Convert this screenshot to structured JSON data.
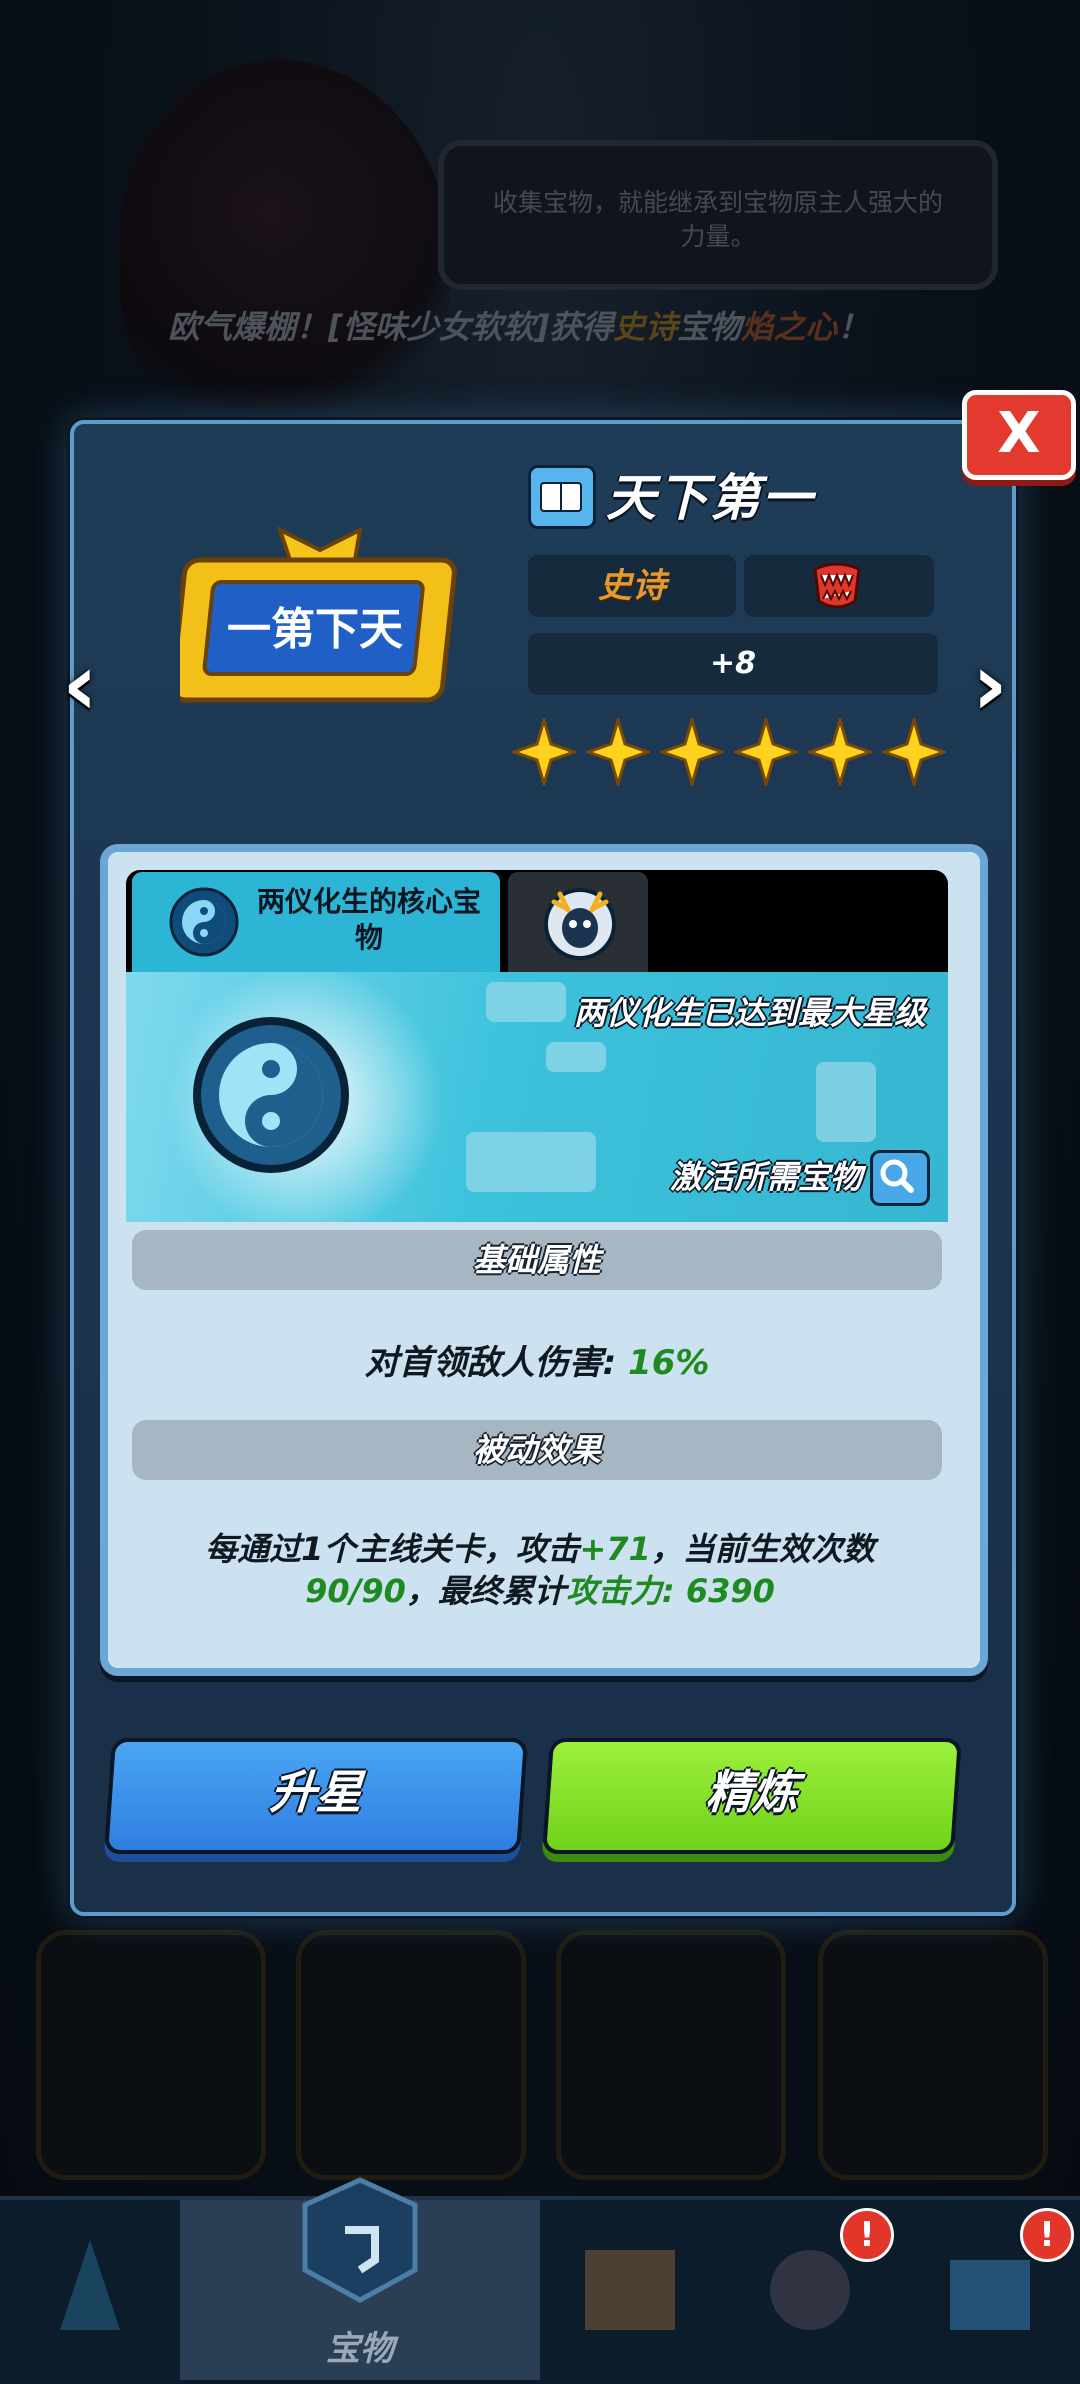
{
  "background": {
    "speech_text": "收集宝物，就能继承到宝物原主人强大的力量。",
    "ticker": {
      "prefix": "欧气爆棚！[怪味少女软软]获得",
      "rarity": "史诗",
      "middle": "宝物",
      "item": "焰之心",
      "suffix": "！"
    }
  },
  "dialog": {
    "close_label": "X",
    "prev_arrow": "‹",
    "next_arrow": "›",
    "title": "天下第一",
    "rarity": "史诗",
    "level": "+8",
    "stars": 6,
    "tabs": [
      {
        "label": "两仪化生的核心宝物",
        "icon": "yin-yang-icon",
        "active": true
      },
      {
        "label": "",
        "icon": "deer-avatar-icon",
        "active": false
      }
    ],
    "banner": {
      "max_star_text": "两仪化生已达到最大星级",
      "need_text": "激活所需宝物"
    },
    "base_section_title": "基础属性",
    "base_stat": {
      "label": "对首领敌人伤害:",
      "value": "16%"
    },
    "passive_section_title": "被动效果",
    "passive": {
      "part1": "每通过1个主线关卡，攻击",
      "bonus": "+71",
      "part2": "，当前生效次数",
      "count": "90/90",
      "part3": "，最终累计",
      "total_label": "攻击力: 6390"
    },
    "buttons": {
      "upgrade": "升星",
      "refine": "精炼"
    }
  },
  "bottom_nav": {
    "active_label": "宝物",
    "badges": [
      "!",
      "!"
    ]
  },
  "colors": {
    "rarity": "#e39a33",
    "green": "#1f8a22",
    "upgrade_button": "#3a8ff0",
    "refine_button": "#86e22a",
    "close": "#e23a2e"
  }
}
